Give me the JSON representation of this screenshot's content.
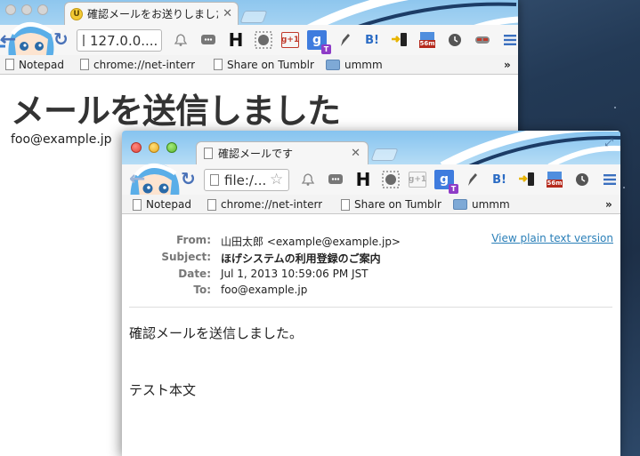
{
  "back_window": {
    "tab_title": "確認メールをお送りしました",
    "favicon_glyph": "U",
    "url": "127.0.0....",
    "bookmarks": [
      "Notepad",
      "chrome://net-interr",
      "Share on Tumblr",
      "ummm"
    ],
    "bookmarks_overflow": "»",
    "heading": "メールを送信しました",
    "email": "foo@example.jp"
  },
  "front_window": {
    "tab_title": "確認メールです",
    "url": "file:/...",
    "bookmarks": [
      "Notepad",
      "chrome://net-interr",
      "Share on Tumblr",
      "ummm"
    ],
    "bookmarks_overflow": "»",
    "view_plain_link": "View plain text version",
    "headers": [
      {
        "key": "From:",
        "value": "山田太郎 <example@example.jp>",
        "bold": false
      },
      {
        "key": "Subject:",
        "value": "ほげシステムの利用登録のご案内",
        "bold": true
      },
      {
        "key": "Date:",
        "value": "Jul 1, 2013 10:59:06 PM JST",
        "bold": false
      },
      {
        "key": "To:",
        "value": "foo@example.jp",
        "bold": false
      }
    ],
    "body_lines": [
      "確認メールを送信しました。",
      "テスト本文"
    ]
  },
  "extensions": {
    "h_label": "H",
    "gplus_label": "g+1",
    "g_label": "g",
    "t_badge": "T",
    "b_label": "B!",
    "timer_badge": "56m"
  },
  "colors": {
    "theme_sky": "#8ec6ee",
    "link": "#2a7fb8",
    "toolbar_bg": "#f6f6f6"
  }
}
